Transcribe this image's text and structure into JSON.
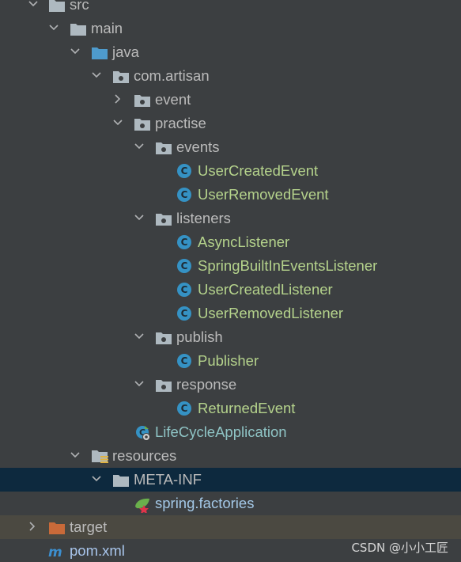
{
  "tree": {
    "src": "src",
    "main": "main",
    "java": "java",
    "com_artisan": "com.artisan",
    "event": "event",
    "practise": "practise",
    "events": "events",
    "user_created_event": "UserCreatedEvent",
    "user_removed_event": "UserRemovedEvent",
    "listeners": "listeners",
    "async_listener": "AsyncListener",
    "spring_built_in_events_listener": "SpringBuiltInEventsListener",
    "user_created_listener": "UserCreatedListener",
    "user_removed_listener": "UserRemovedListener",
    "publish": "publish",
    "publisher": "Publisher",
    "response": "response",
    "returned_event": "ReturnedEvent",
    "life_cycle_application": "LifeCycleApplication",
    "resources": "resources",
    "meta_inf": "META-INF",
    "spring_factories": "spring.factories",
    "target": "target",
    "pom_xml": "pom.xml"
  },
  "class_icon_letter": "C",
  "watermark": "CSDN @小小工匠",
  "colors": {
    "background": "#3c3f41",
    "selected_row": "#0d293e",
    "excluded_row": "#4b4941",
    "class_icon": "#3592c4",
    "folder": "#aeb9c0",
    "source_folder": "#4e9bcd",
    "target_folder": "#c96a39"
  }
}
